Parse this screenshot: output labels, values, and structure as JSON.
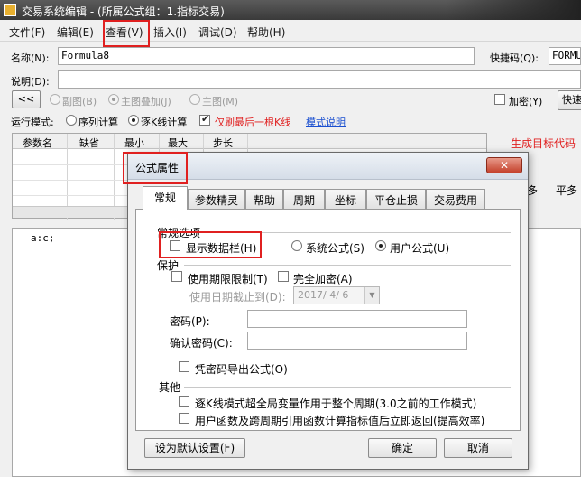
{
  "window": {
    "title": "交易系统编辑 - (所属公式组：1.指标交易)"
  },
  "menu": [
    "文件(F)",
    "编辑(E)",
    "查看(V)",
    "插入(I)",
    "调试(D)",
    "帮助(H)"
  ],
  "form": {
    "name_label": "名称(N):",
    "name_value": "Formula8",
    "shortcut_label": "快捷码(Q):",
    "shortcut_value": "FORMUL",
    "desc_label": "说明(D):",
    "collapse_btn": "<<",
    "radio_sub": "副图(B)",
    "radio_main_overlay": "主图叠加(J)",
    "radio_main": "主图(M)",
    "encrypt_label": "加密(Y)",
    "quick_btn": "快速",
    "mode_label": "运行模式:",
    "mode_seq": "序列计算",
    "mode_tick": "逐K线计算",
    "refresh_last": "仅刷最后一根K线",
    "mode_help": "模式说明",
    "gen_code": "生成目标代码",
    "side_left": "多",
    "side_right": "平多"
  },
  "grid": {
    "headers": [
      "参数名",
      "缺省",
      "最小",
      "最大",
      "步长"
    ]
  },
  "editor": {
    "code": "a:c;"
  },
  "dialog": {
    "title": "公式属性",
    "tabs": [
      "常规",
      "参数精灵",
      "帮助",
      "周期",
      "坐标",
      "平仓止损",
      "交易费用"
    ],
    "group_general": "常规选项",
    "show_databar": "显示数据栏(H)",
    "system_formula": "系统公式(S)",
    "user_formula": "用户公式(U)",
    "group_protect": "保护",
    "use_period_limit": "使用期限限制(T)",
    "full_encrypt": "完全加密(A)",
    "date_label": "使用日期截止到(D):",
    "date_value": "2017/ 4/ 6",
    "password_label": "密码(P):",
    "confirm_label": "确认密码(C):",
    "export_pwd": "凭密码导出公式(O)",
    "group_other": "其他",
    "other_opt1": "逐K线模式超全局变量作用于整个周期(3.0之前的工作模式)",
    "other_opt2": "用户函数及跨周期引用函数计算指标值后立即返回(提高效率)",
    "default_btn": "设为默认设置(F)",
    "ok_btn": "确定",
    "cancel_btn": "取消"
  }
}
